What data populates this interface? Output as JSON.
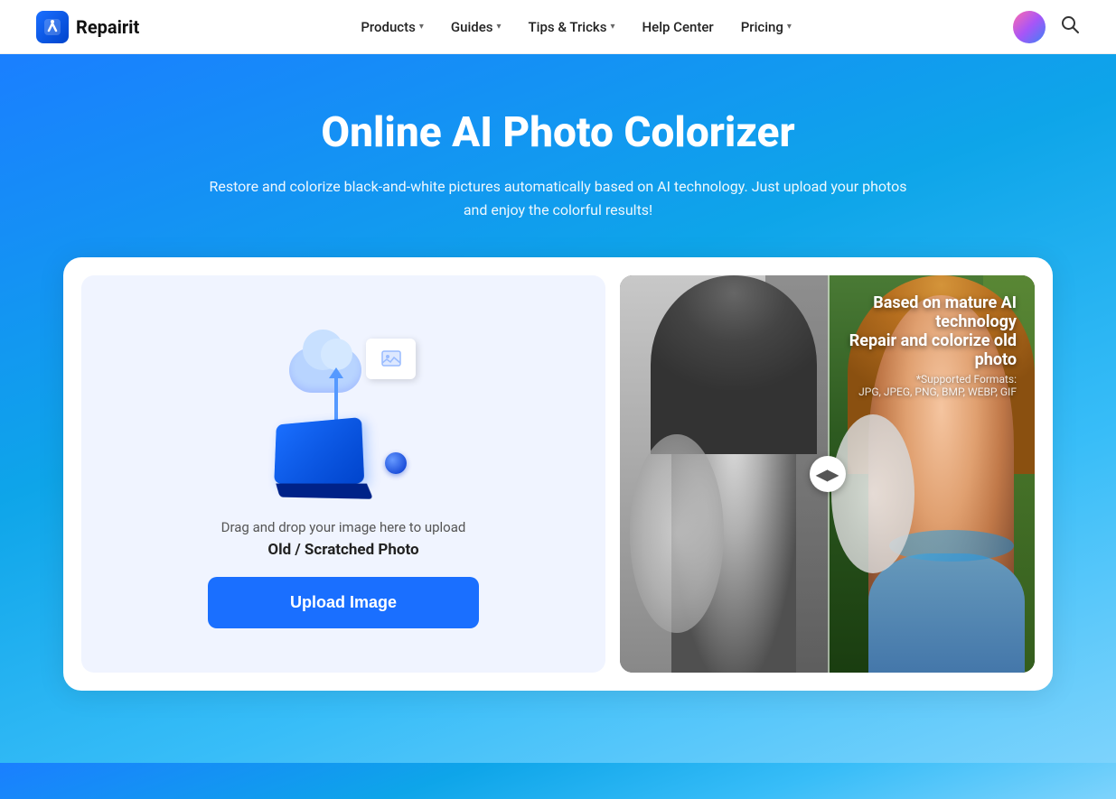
{
  "nav": {
    "logo_text": "Repairit",
    "items": [
      {
        "label": "Products",
        "has_dropdown": true
      },
      {
        "label": "Guides",
        "has_dropdown": true
      },
      {
        "label": "Tips & Tricks",
        "has_dropdown": true
      },
      {
        "label": "Help Center",
        "has_dropdown": false
      },
      {
        "label": "Pricing",
        "has_dropdown": true
      }
    ]
  },
  "hero": {
    "title": "Online AI Photo Colorizer",
    "subtitle": "Restore and colorize black-and-white pictures automatically based on AI technology. Just upload your photos and enjoy the colorful results!"
  },
  "upload": {
    "drag_drop_text": "Drag and drop your image here to upload",
    "file_type_label": "Old / Scratched Photo",
    "button_label": "Upload Image"
  },
  "preview": {
    "overlay_line1": "Based on mature AI technology",
    "overlay_line2": "Repair and colorize old photo",
    "overlay_line3": "*Supported Formats:",
    "overlay_line4": "JPG, JPEG, PNG, BMP, WEBP, GIF"
  }
}
